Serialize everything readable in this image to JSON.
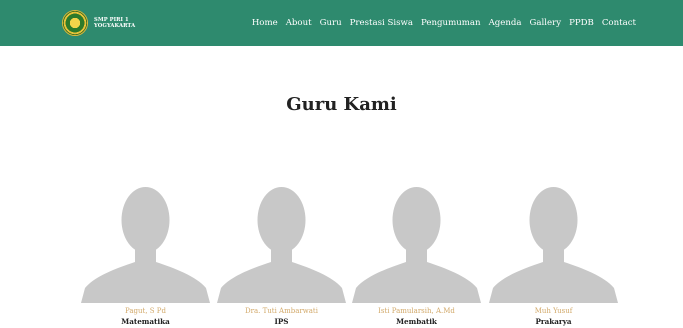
{
  "brand": {
    "line1": "SMP PIRI 1",
    "line2": "YOGYAKARTA"
  },
  "nav": [
    "Home",
    "About",
    "Guru",
    "Prestasi Siswa",
    "Pengumuman",
    "Agenda",
    "Gallery",
    "PPDB",
    "Contact"
  ],
  "section": {
    "title": "Guru Kami"
  },
  "teachers": [
    {
      "name": "Pagut, S Pd",
      "subject": "Matematika"
    },
    {
      "name": "Dra. Tuti Ambarwati",
      "subject": "IPS"
    },
    {
      "name": "Isti Pamularsih, A.Md",
      "subject": "Membatik"
    },
    {
      "name": "Muh Yusuf",
      "subject": "Prakarya"
    }
  ],
  "colors": {
    "navbar": "#2e8a6e",
    "teacher_name": "#d2a96a",
    "avatar": "#c8c8c8"
  }
}
